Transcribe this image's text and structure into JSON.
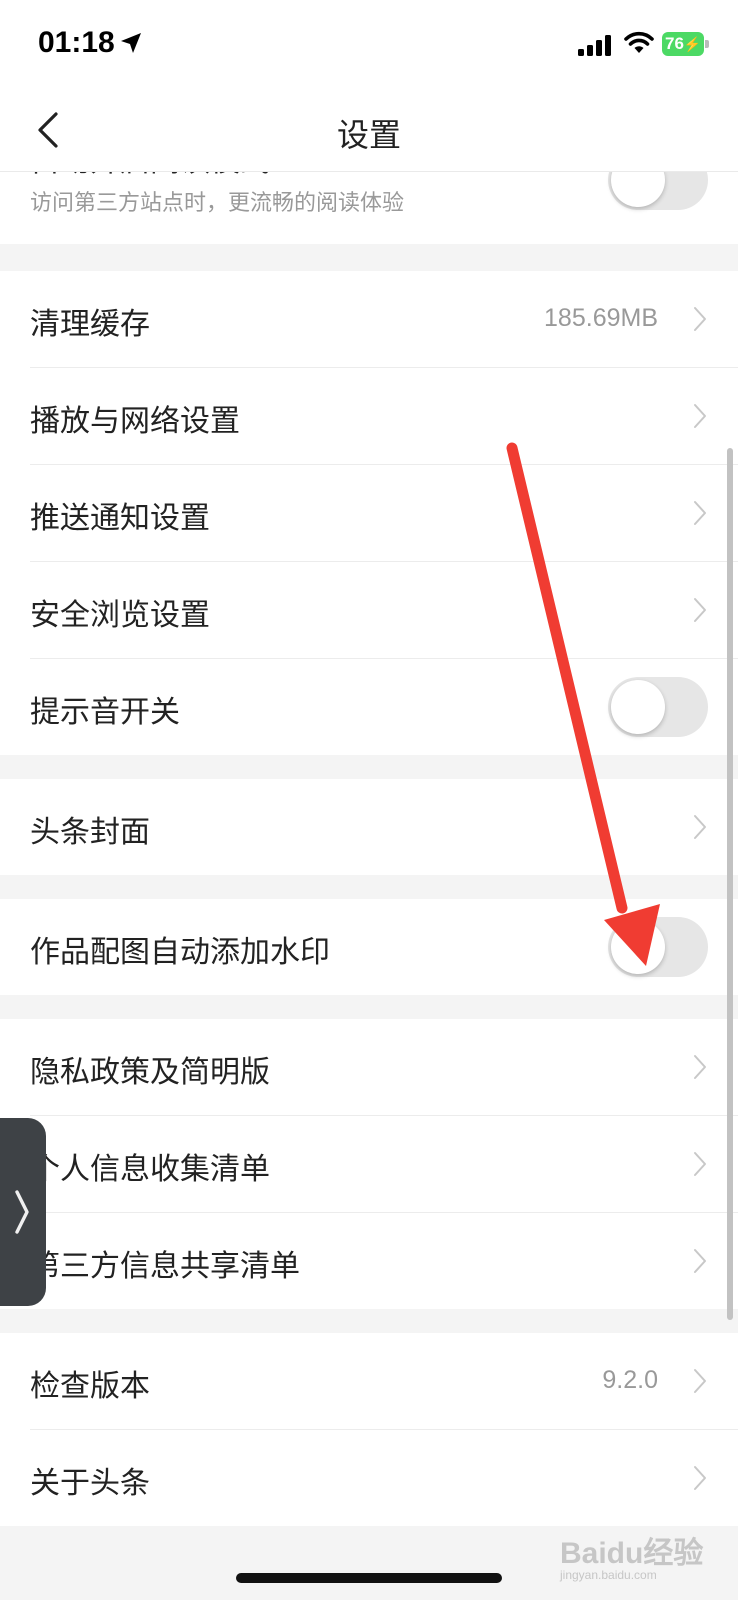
{
  "status_bar": {
    "time": "01:18",
    "battery": "76"
  },
  "nav": {
    "title": "设置"
  },
  "rows": {
    "reading_mode": {
      "label": "自动开启阅读模式",
      "subtitle": "访问第三方站点时，更流畅的阅读体验",
      "toggle_on": false
    },
    "clear_cache": {
      "label": "清理缓存",
      "value": "185.69MB"
    },
    "playback_network": {
      "label": "播放与网络设置"
    },
    "push_notification": {
      "label": "推送通知设置"
    },
    "safe_browsing": {
      "label": "安全浏览设置"
    },
    "sound_switch": {
      "label": "提示音开关",
      "toggle_on": false
    },
    "headline_cover": {
      "label": "头条封面"
    },
    "auto_watermark": {
      "label": "作品配图自动添加水印",
      "toggle_on": false
    },
    "privacy_policy": {
      "label": "隐私政策及简明版"
    },
    "personal_info": {
      "label": "个人信息收集清单"
    },
    "third_party_sharing": {
      "label": "第三方信息共享清单"
    },
    "check_version": {
      "label": "检查版本",
      "value": "9.2.0"
    },
    "about": {
      "label": "关于头条"
    }
  },
  "watermark": {
    "brand": "Baidu经验",
    "url": "jingyan.baidu.com"
  },
  "colors": {
    "annotation_arrow": "#f03c32",
    "battery": "#4cd964",
    "toggle_off": "#e6e6e6"
  }
}
